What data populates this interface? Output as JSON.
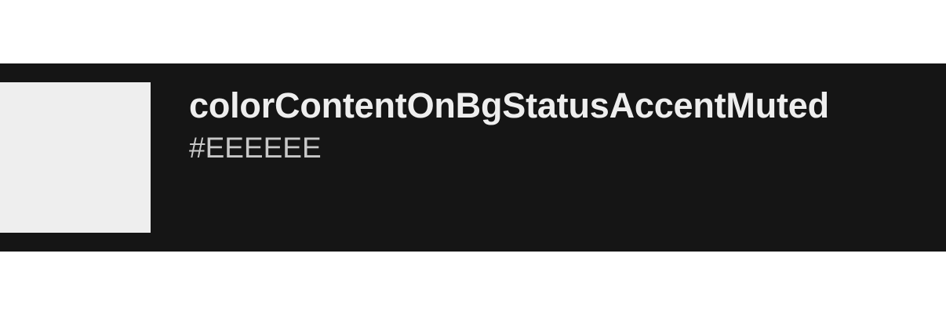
{
  "token": {
    "name": "colorContentOnBgStatusAccentMuted",
    "value": "#EEEEEE",
    "swatch_color": "#EEEEEE"
  },
  "colors": {
    "card_background": "#151515",
    "page_background": "#FFFFFF"
  }
}
